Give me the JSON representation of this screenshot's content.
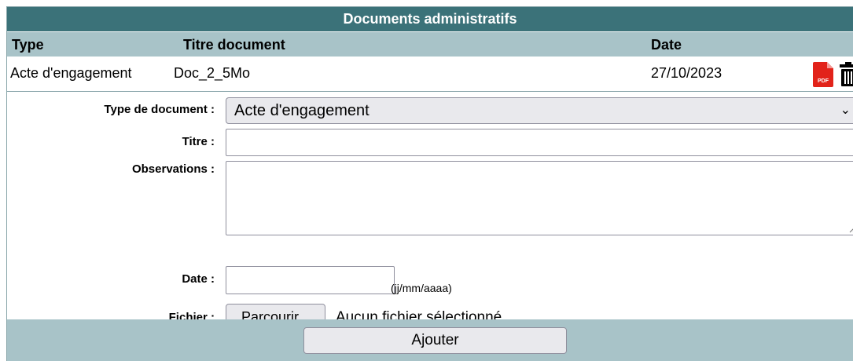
{
  "panel": {
    "title": "Documents administratifs"
  },
  "table": {
    "headers": {
      "type": "Type",
      "titre": "Titre document",
      "date": "Date"
    },
    "rows": [
      {
        "type": "Acte d'engagement",
        "titre": "Doc_2_5Mo",
        "date": "27/10/2023",
        "pdf_icon": "pdf-icon",
        "delete_icon": "trash-icon"
      }
    ]
  },
  "form": {
    "type_label": "Type de document :",
    "type_value": "Acte d'engagement",
    "titre_label": "Titre :",
    "titre_value": "",
    "observations_label": "Observations :",
    "observations_value": "",
    "date_label": "Date :",
    "date_value": "",
    "date_hint": "(jj/mm/aaaa)",
    "fichier_label": "Fichier :",
    "browse_label": "Parcourir...",
    "no_file_text": "Aucun fichier sélectionné.",
    "submit_label": "Ajouter"
  },
  "colors": {
    "title_bar": "#3b7279",
    "header_bg": "#a8c3c8",
    "pdf_red": "#e2231a"
  }
}
